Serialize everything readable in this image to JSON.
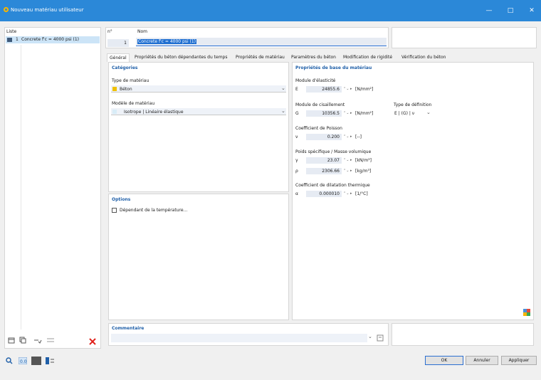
{
  "window": {
    "title": "Nouveau matériau utilisateur",
    "minimize": "—",
    "maximize": "□",
    "close": "✕"
  },
  "list": {
    "header": "Liste",
    "items": [
      {
        "number": "1",
        "label": "Concrete f'c = 4000 psi (1)"
      }
    ]
  },
  "header": {
    "no_label": "n°",
    "no_value": "1",
    "name_label": "Nom",
    "name_value": "Concrete f'c = 4000 psi (1)"
  },
  "tabs": [
    "Général",
    "Propriétés du béton dépendantes du temps",
    "Propriétés de matériau",
    "Paramètres du béton",
    "Modification de rigidité",
    "Vérification du béton"
  ],
  "categories": {
    "title": "Catégories",
    "type_label": "Type de matériau",
    "type_value": "Béton",
    "type_color": "#f0c000",
    "model_label": "Modèle de matériau",
    "model_value": "Isotrope | Linéaire élastique",
    "model_color": "#d8ecf7"
  },
  "options": {
    "title": "Options",
    "temp_dependent": "Dépendant de la température..."
  },
  "properties": {
    "title": "Propriétés de base du matériau",
    "elasticity": {
      "label": "Module d'élasticité",
      "symbol": "E",
      "value": "24855.6",
      "unit": "[N/mm²]"
    },
    "shear": {
      "label": "Module de cisaillement",
      "symbol": "G",
      "value": "10356.5",
      "unit": "[N/mm²]"
    },
    "definition_type": {
      "label": "Type de définition",
      "value": "E | (G) | ν"
    },
    "poisson": {
      "label": "Coefficient de Poisson",
      "symbol": "ν",
      "value": "0.200",
      "unit": "[--]"
    },
    "weight_header": "Poids spécifique / Masse volumique",
    "gamma": {
      "symbol": "γ",
      "value": "23.07",
      "unit": "[kN/m³]"
    },
    "rho": {
      "symbol": "ρ",
      "value": "2306.66",
      "unit": "[kg/m³]"
    },
    "thermal": {
      "label": "Coefficient de dilatation thermique",
      "symbol": "α",
      "value": "0.000010",
      "unit": "[1/°C]"
    }
  },
  "comment": {
    "label": "Commentaire"
  },
  "buttons": {
    "ok": "OK",
    "cancel": "Annuler",
    "apply": "Appliquer"
  },
  "colors": {
    "titlebar": "#2b88d8",
    "header_text": "#1f5fa8",
    "delete": "#e0201a"
  }
}
